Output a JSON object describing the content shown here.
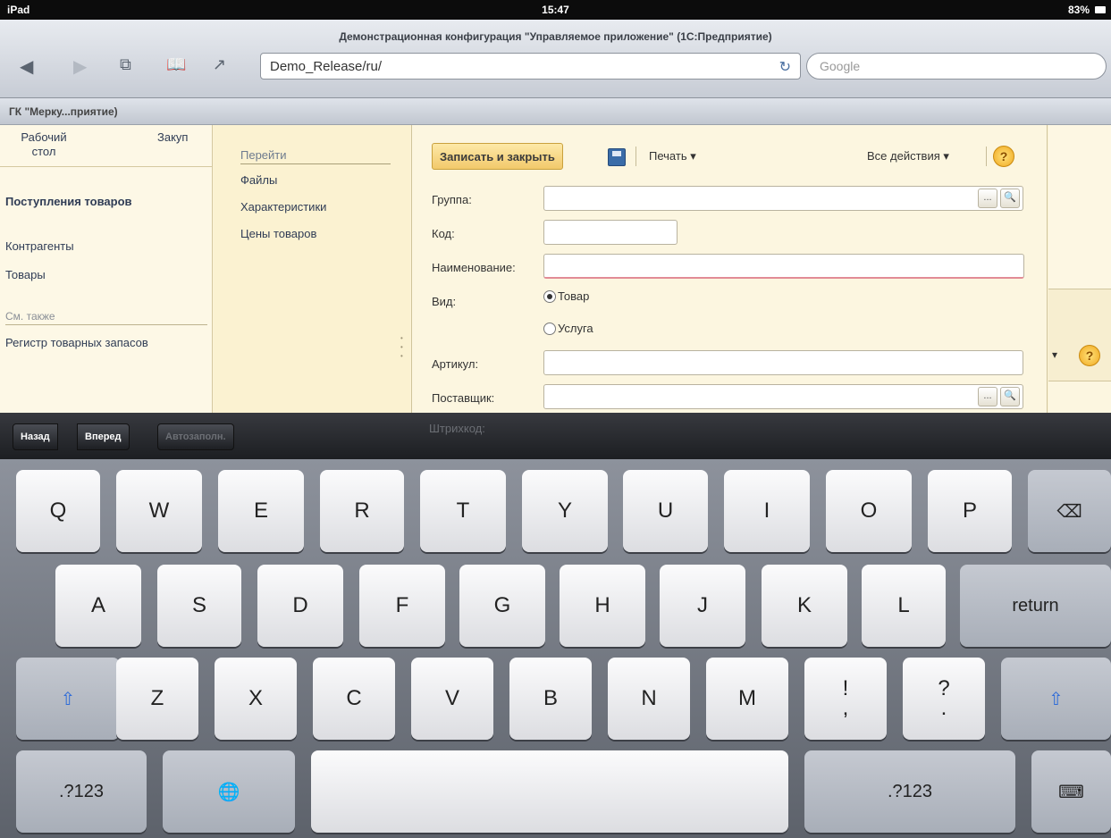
{
  "status": {
    "device": "iPad",
    "time": "15:47",
    "battery": "83%"
  },
  "safari": {
    "title": "Демонстрационная конфигурация \"Управляемое приложение\" (1С:Предприятие)",
    "url": "Demo_Release/ru/",
    "search_placeholder": "Google",
    "tab_label": "ГК \"Мерку...приятие)"
  },
  "sections": {
    "desktop": "Рабочий стол",
    "purchases": "Закуп"
  },
  "left_nav": {
    "main": "Поступления товаров",
    "items": [
      "Контрагенты",
      "Товары"
    ],
    "see_also": "См. также",
    "see_also_items": [
      "Регистр товарных запасов"
    ]
  },
  "goto": {
    "title": "Перейти",
    "items": [
      "Файлы",
      "Характеристики",
      "Цены товаров"
    ]
  },
  "form": {
    "save_close": "Записать и закрыть",
    "print": "Печать",
    "all_actions": "Все действия",
    "help": "?",
    "labels": {
      "group": "Группа:",
      "code": "Код:",
      "name": "Наименование:",
      "kind": "Вид:",
      "article": "Артикул:",
      "supplier": "Поставщик:",
      "barcode": "Штрихкод:"
    },
    "kind_options": [
      "Товар",
      "Услуга"
    ],
    "kind_selected": "Товар",
    "ellipsis": "...",
    "search_glyph": "🔍"
  },
  "accessory": {
    "back": "Назад",
    "forward": "Вперед",
    "autofill": "Автозаполн."
  },
  "keyboard": {
    "row1": [
      "Q",
      "W",
      "E",
      "R",
      "T",
      "Y",
      "U",
      "I",
      "O",
      "P"
    ],
    "row2": [
      "A",
      "S",
      "D",
      "F",
      "G",
      "H",
      "J",
      "K",
      "L"
    ],
    "return": "return",
    "row3": [
      "Z",
      "X",
      "C",
      "V",
      "B",
      "N",
      "M"
    ],
    "punct1_top": "!",
    "punct1_bottom": ",",
    "punct2_top": "?",
    "punct2_bottom": ".",
    "numbers": ".?123"
  }
}
